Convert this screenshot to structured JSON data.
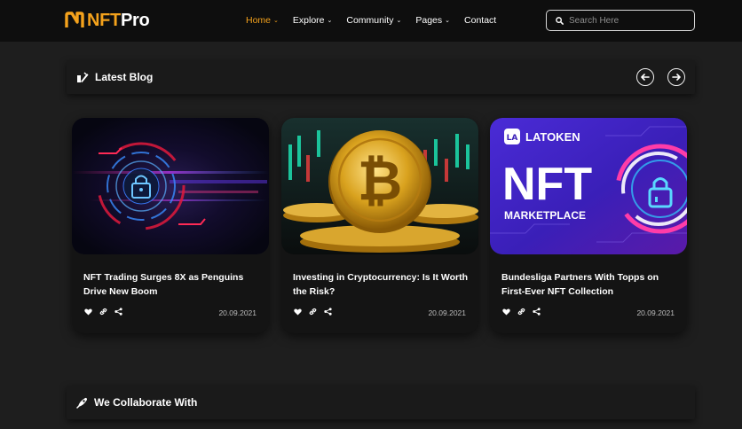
{
  "brand": {
    "logo_accent": "NFT",
    "logo_rest": "Pro",
    "accent_color": "#f4a21c"
  },
  "nav": {
    "items": [
      {
        "label": "Home",
        "has_dropdown": true,
        "active": true
      },
      {
        "label": "Explore",
        "has_dropdown": true,
        "active": false
      },
      {
        "label": "Community",
        "has_dropdown": true,
        "active": false
      },
      {
        "label": "Pages",
        "has_dropdown": true,
        "active": false
      },
      {
        "label": "Contact",
        "has_dropdown": false,
        "active": false
      }
    ]
  },
  "search": {
    "placeholder": "Search Here",
    "icon": "search-icon"
  },
  "latest_blog": {
    "title": "Latest Blog",
    "icon": "blog-icon",
    "prev_icon": "arrow-left-icon",
    "next_icon": "arrow-right-icon",
    "cards": [
      {
        "title": "NFT Trading Surges 8X as Penguins Drive New Boom",
        "date": "20.09.2021",
        "image": "cyber-lock-image"
      },
      {
        "title": "Investing in Cryptocurrency: Is It Worth the Risk?",
        "date": "20.09.2021",
        "image": "bitcoin-coins-image"
      },
      {
        "title": "Bundesliga Partners With Topps on First-Ever NFT Collection",
        "date": "20.09.2021",
        "image": "latoken-nft-marketplace-image",
        "image_text": {
          "brand": "LATOKEN",
          "badge": "LA",
          "headline": "NFT",
          "sub": "MARKETPLACE"
        }
      }
    ],
    "card_action_icons": [
      "heart-icon",
      "link-icon",
      "share-icon"
    ]
  },
  "collaborate": {
    "title": "We Collaborate With",
    "icon": "rocket-icon"
  }
}
